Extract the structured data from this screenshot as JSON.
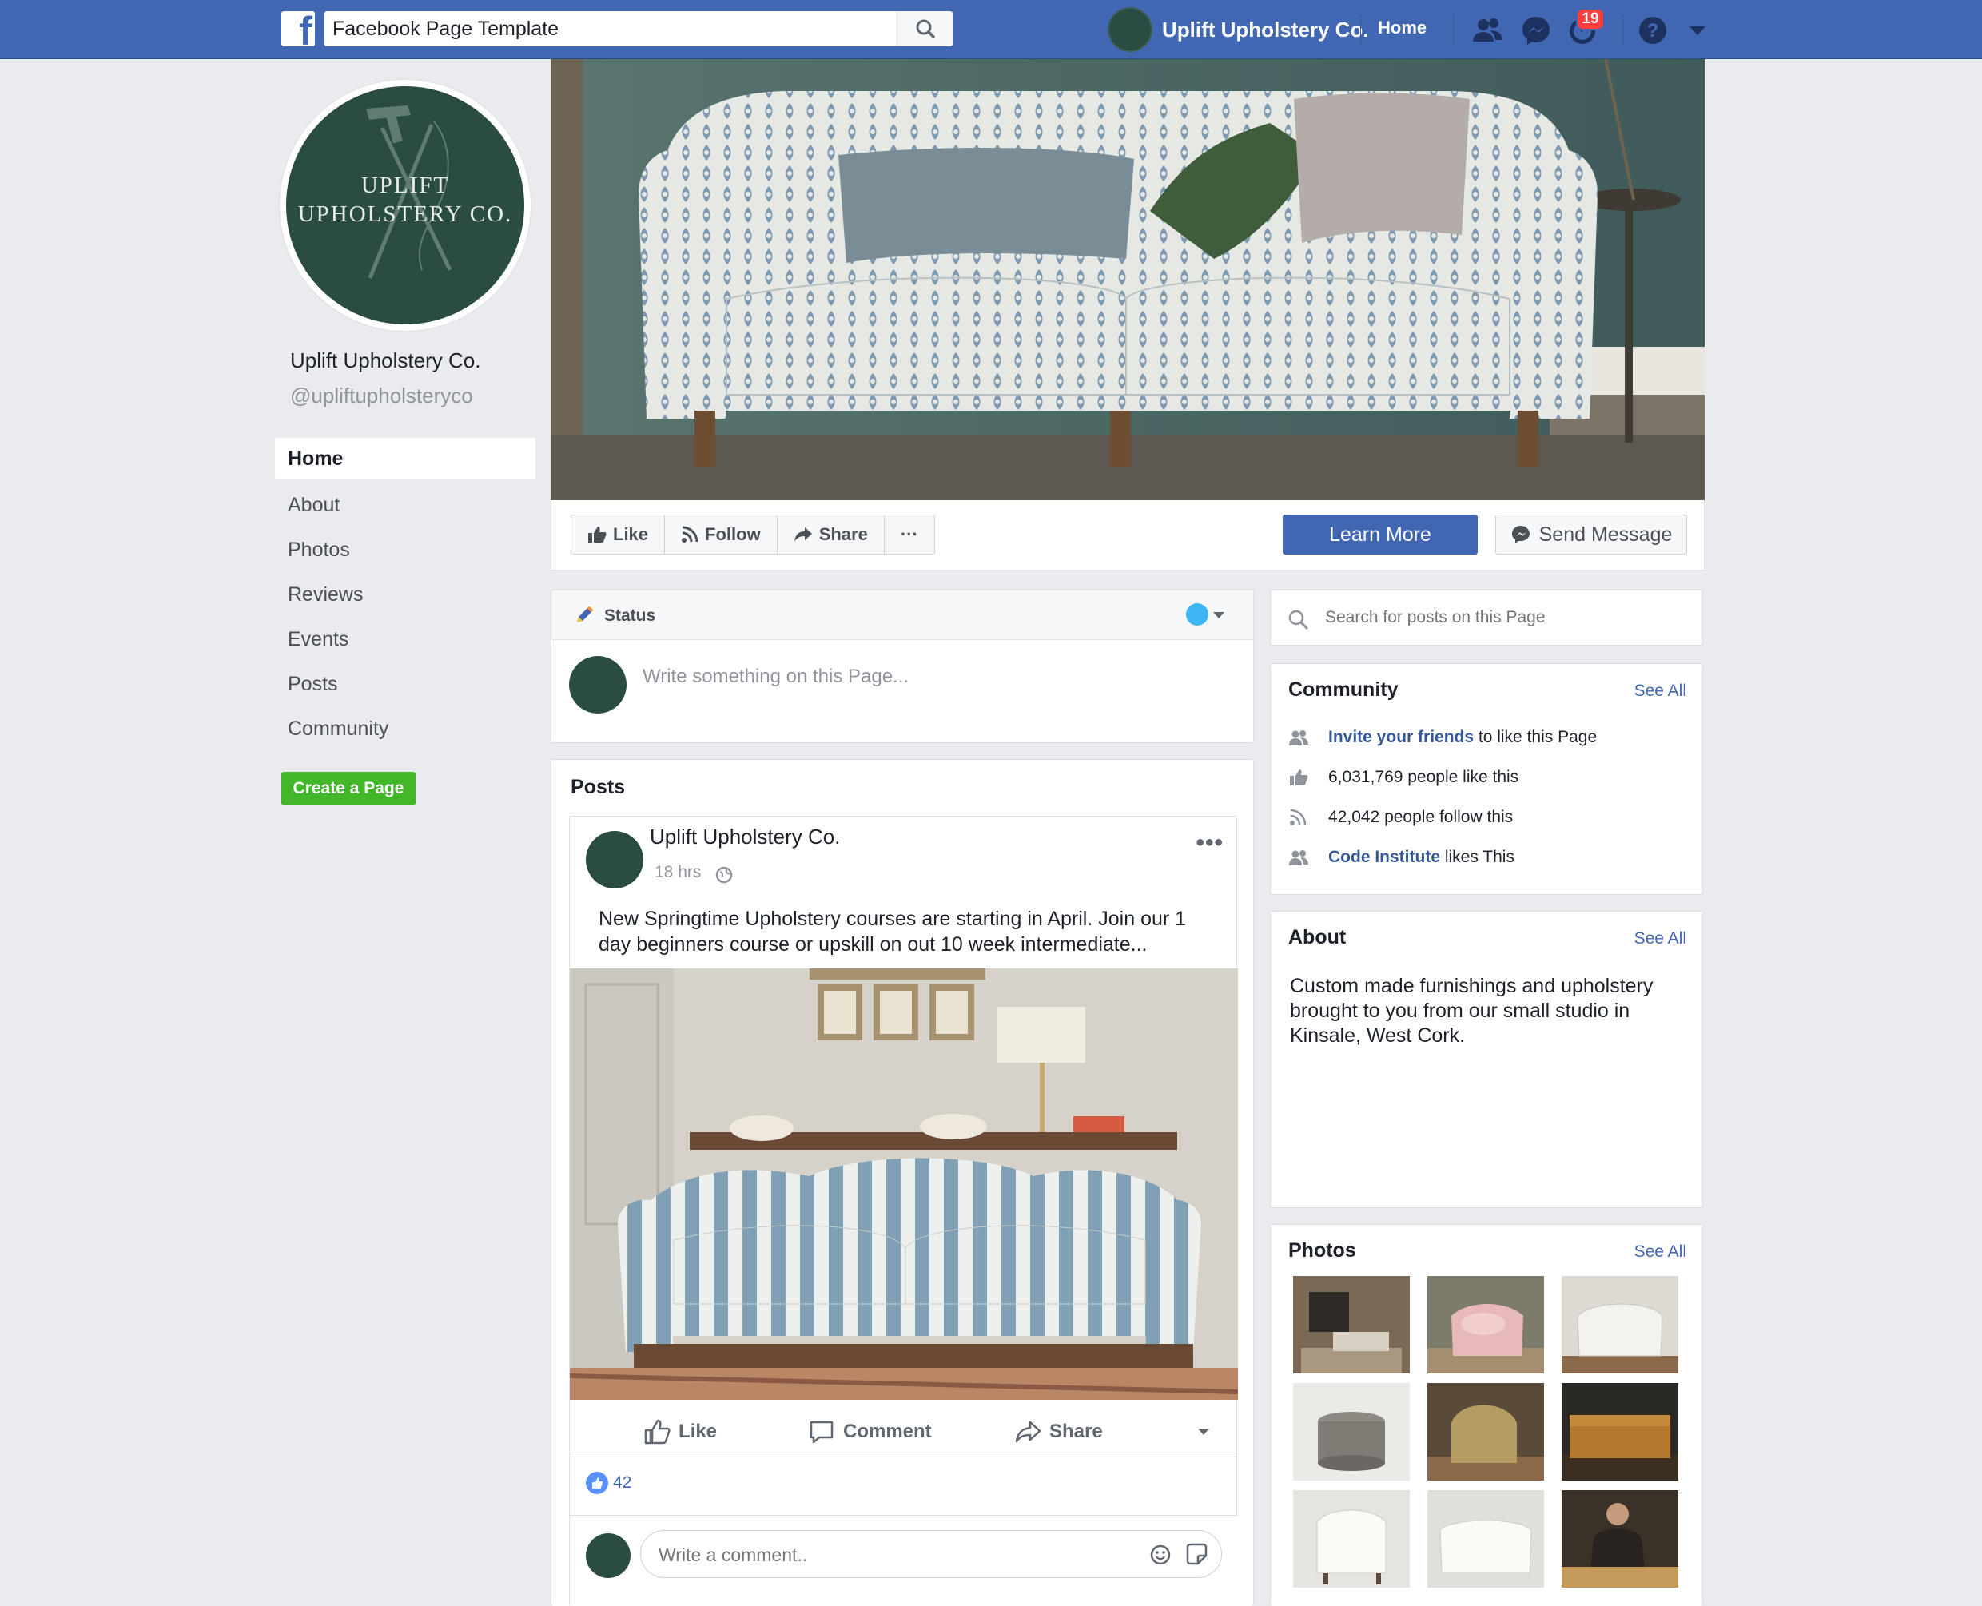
{
  "topbar": {
    "search_value": "Facebook Page Template",
    "profile_name": "Uplift Upholstery Co.",
    "home_label": "Home",
    "notification_count": "19",
    "icons": [
      "facebook-logo-icon",
      "search-icon",
      "friends-icon",
      "messenger-icon",
      "notifications-icon",
      "help-icon",
      "account-menu-icon"
    ],
    "brand_color": "#4267b2"
  },
  "profile": {
    "logo_line1": "UPLIFT",
    "logo_line2": "UPHOLSTERY CO.",
    "name": "Uplift Upholstery Co.",
    "handle": "@upliftupholsteryco",
    "logo_color": "#2b4c42"
  },
  "sidebar": {
    "items": [
      {
        "label": "Home",
        "active": true
      },
      {
        "label": "About"
      },
      {
        "label": "Photos"
      },
      {
        "label": "Reviews"
      },
      {
        "label": "Events"
      },
      {
        "label": "Posts"
      },
      {
        "label": "Community"
      }
    ],
    "create_page": "Create a Page"
  },
  "cover_actions": {
    "like": "Like",
    "follow": "Follow",
    "share": "Share",
    "more": "···",
    "learn_more": "Learn More",
    "send_message": "Send Message"
  },
  "composer": {
    "tab_label": "Status",
    "placeholder": "Write something on this Page..."
  },
  "posts": {
    "title": "Posts",
    "post": {
      "author": "Uplift Upholstery Co.",
      "time": "18 hrs",
      "text": "New Springtime Upholstery courses are starting in April. Join our 1 day beginners course or upskill on out 10 week intermediate...",
      "like_label": "Like",
      "comment_label": "Comment",
      "share_label": "Share",
      "reaction_count": "42",
      "comment_placeholder": "Write a comment.."
    }
  },
  "right": {
    "search_placeholder": "Search for posts on this Page",
    "community": {
      "title": "Community",
      "see_all": "See All",
      "invite_link": "Invite your friends",
      "invite_rest": " to like this Page",
      "likes": "6,031,769 people like this",
      "follows": "42,042 people follow this",
      "liker_link": "Code Institute",
      "liker_rest": " likes This"
    },
    "about": {
      "title": "About",
      "see_all": "See All",
      "text": "Custom made furnishings and upholstery brought to you from our small studio in Kinsale, West Cork."
    },
    "photos": {
      "title": "Photos",
      "see_all": "See All"
    }
  }
}
